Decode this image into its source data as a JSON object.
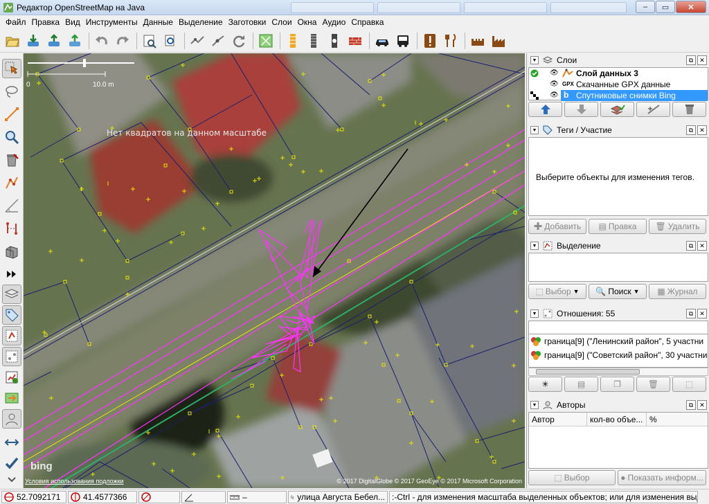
{
  "window": {
    "title": "Редактор OpenStreetMap на Java",
    "buttons": [
      "–",
      "▭",
      "✕"
    ]
  },
  "menu": [
    "Файл",
    "Правка",
    "Вид",
    "Инструменты",
    "Данные",
    "Выделение",
    "Заготовки",
    "Слои",
    "Окна",
    "Аудио",
    "Справка"
  ],
  "toolbar_icons": [
    "open-icon",
    "upload-icon",
    "save-icon",
    "export-icon",
    "undo-icon",
    "redo-icon",
    "preferences-icon",
    "search-icon",
    "split-way-icon",
    "combine-icon",
    "refresh-icon",
    "map-area-icon",
    "traffic-light-icon",
    "rail-icon",
    "stop-icon",
    "wall-icon",
    "car-icon",
    "bus-icon",
    "warning-icon",
    "restaurant-icon",
    "castle-icon",
    "factory-icon"
  ],
  "map": {
    "scale": {
      "left": "0",
      "right": "10.0 m"
    },
    "no_squares": "Нет квадратов на данном масштабе",
    "bing": "bing",
    "terms": "Условия использования подложки",
    "copyright": "© 2017 DigitalGlobe © 2017 GeoEye © 2017 Microsoft Corporation"
  },
  "layers": {
    "title": "Слои",
    "items": [
      {
        "name": "Слой данных 3",
        "active": true,
        "selected": false
      },
      {
        "name": "Скачанные GPX данные",
        "prefix": "GPX",
        "active": false,
        "selected": false
      },
      {
        "name": "Спутниковые снимки Bing",
        "active": false,
        "selected": true
      }
    ]
  },
  "tags": {
    "title": "Теги / Участие",
    "empty_message": "Выберите объекты для изменения тегов.",
    "buttons": {
      "add": "Добавить",
      "edit": "Правка",
      "delete": "Удалить"
    }
  },
  "selection": {
    "title": "Выделение",
    "buttons": {
      "select": "Выбор",
      "search": "Поиск",
      "history": "Журнал"
    }
  },
  "relations": {
    "title": "Отношения: 55",
    "items": [
      "граница[9] (\"Ленинский район\", 5 участни",
      "граница[9] (\"Советский район\", 30 участни"
    ]
  },
  "authors": {
    "title": "Авторы",
    "columns": [
      "Автор",
      "кол-во объе...",
      "%"
    ],
    "buttons": {
      "select": "Выбор",
      "show_info": "Показать информ..."
    }
  },
  "status": {
    "lat": "52.7092171",
    "lon": "41.4577366",
    "heading": "",
    "angle": "",
    "distance": "–",
    "name": "улица Августа Бебел...",
    "help": ":-Ctrl - для изменения масштаба выделенных объектов; или для изменения выделения"
  },
  "colors": {
    "selection_blue": "#3399ff",
    "gpx_track": "#ff33ff",
    "way_yellow": "#e6e600",
    "way_green": "#2fae6a"
  }
}
